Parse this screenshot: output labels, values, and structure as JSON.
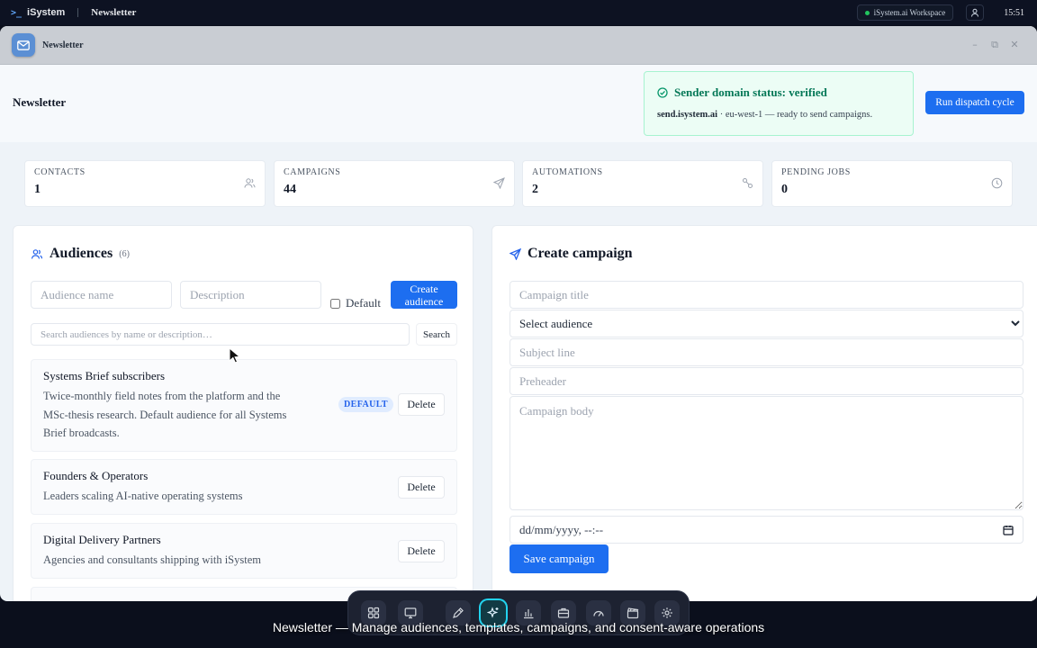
{
  "system_bar": {
    "brand": "iSystem",
    "app_name": "Newsletter",
    "workspace": "iSystem.ai Workspace",
    "time": "15:51"
  },
  "window": {
    "title": "Newsletter"
  },
  "header": {
    "title": "Newsletter",
    "status_title": "Sender domain status: verified",
    "status_domain": "send.isystem.ai",
    "status_detail": " · eu-west-1 — ready to send campaigns.",
    "dispatch_label": "Run dispatch cycle"
  },
  "stats": [
    {
      "label": "CONTACTS",
      "value": "1",
      "icon": "users-icon"
    },
    {
      "label": "CAMPAIGNS",
      "value": "44",
      "icon": "send-icon"
    },
    {
      "label": "AUTOMATIONS",
      "value": "2",
      "icon": "workflow-icon"
    },
    {
      "label": "PENDING JOBS",
      "value": "0",
      "icon": "clock-icon"
    }
  ],
  "audiences": {
    "title": "Audiences",
    "count": "(6)",
    "name_placeholder": "Audience name",
    "desc_placeholder": "Description",
    "default_label": "Default",
    "create_label": "Create audience",
    "search_placeholder": "Search audiences by name or description…",
    "search_label": "Search",
    "items": [
      {
        "name": "Systems Brief subscribers",
        "desc_lines": [
          "Twice-monthly field notes from the platform and the",
          "MSc-thesis research. Default audience for all Systems",
          "Brief broadcasts."
        ],
        "badge": "DEFAULT",
        "delete_label": "Delete"
      },
      {
        "name": "Founders & Operators",
        "desc_lines": [
          "Leaders scaling AI-native operating systems"
        ],
        "delete_label": "Delete"
      },
      {
        "name": "Digital Delivery Partners",
        "desc_lines": [
          "Agencies and consultants shipping with iSystem"
        ],
        "delete_label": "Delete"
      }
    ]
  },
  "campaign": {
    "title": "Create campaign",
    "title_placeholder": "Campaign title",
    "audience_select": "Select audience",
    "subject_placeholder": "Subject line",
    "preheader_placeholder": "Preheader",
    "body_placeholder": "Campaign body",
    "schedule_placeholder": "dd/mm/yyyy, --:--",
    "save_label": "Save campaign"
  },
  "caption": "Newsletter — Manage audiences, templates, campaigns, and consent-aware operations",
  "dock_icons": [
    "grid-icon",
    "monitor-icon",
    "pen-icon",
    "sparkles-icon",
    "bar-chart-icon",
    "briefcase-icon",
    "gauge-icon",
    "clapperboard-icon",
    "gear-icon"
  ],
  "colors": {
    "primary": "#1d6ef0",
    "success": "#047857",
    "badge_bg": "#e0ecff",
    "dock_active": "#22d3ee"
  }
}
